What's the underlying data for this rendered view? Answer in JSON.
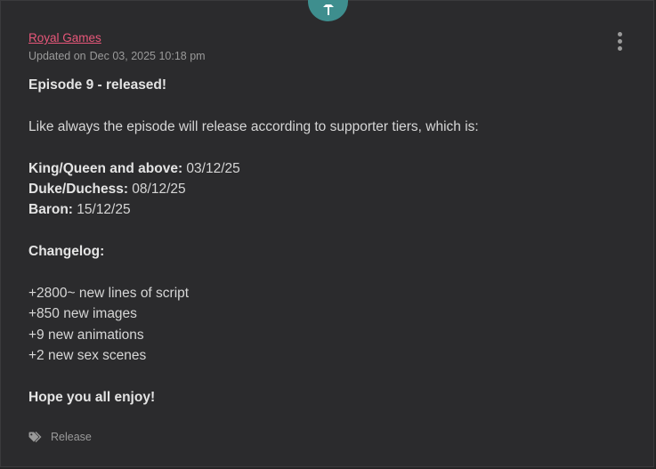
{
  "post": {
    "author": "Royal Games",
    "updated_label": "Updated on",
    "updated_date": "Dec 03, 2025 10:18 pm",
    "title": "Episode 9 - released!",
    "intro": "Like always the episode will release according to supporter tiers, which is:",
    "tiers": [
      {
        "name": "King/Queen and above:",
        "date": "03/12/25"
      },
      {
        "name": "Duke/Duchess:",
        "date": "08/12/25"
      },
      {
        "name": "Baron:",
        "date": "15/12/25"
      }
    ],
    "changelog_heading": "Changelog:",
    "changelog": [
      "+2800~ new lines of script",
      "+850 new images",
      "+9 new animations",
      "+2 new sex scenes"
    ],
    "closing": "Hope you all enjoy!",
    "tag": "Release"
  },
  "icons": {
    "pin": "pin-icon",
    "menu": "more-vertical-icon",
    "tag": "tag-icon"
  },
  "colors": {
    "background": "#2b2b2d",
    "author_link": "#e8577a",
    "pin_badge": "#3e8e8e",
    "text": "#d6d6d6",
    "muted": "#9a9a9a"
  }
}
